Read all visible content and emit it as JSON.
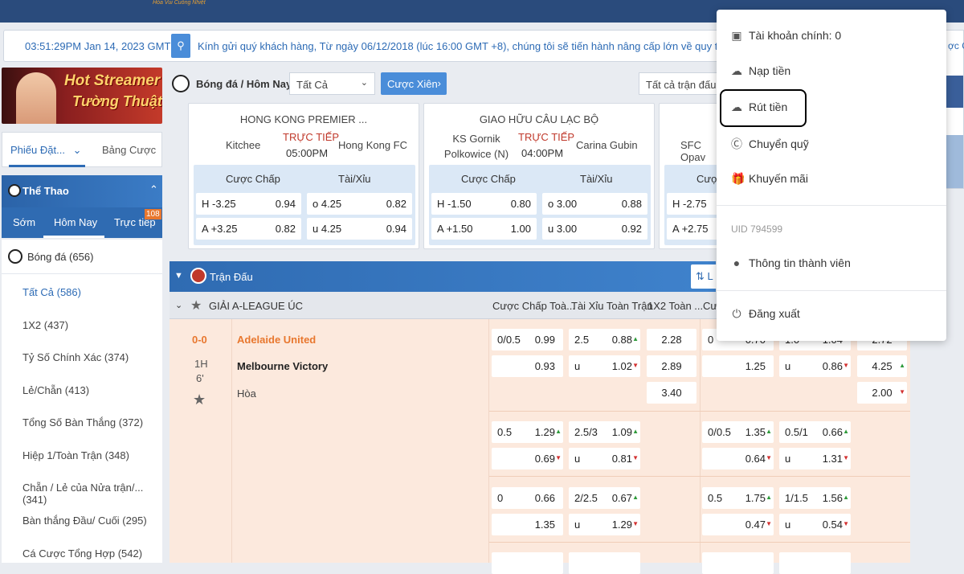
{
  "header": {
    "tagline": "Hòa Vui Cuồng Nhiệt"
  },
  "ticker": {
    "time": "03:51:29PM Jan 14, 2023 GMT +7",
    "message": "Kính gửi quý khách hàng, Từ ngày 06/12/2018 (lúc 16:00 GMT +8), chúng tôi sẽ tiến hành nâng cấp lớn về quy trình tiếp nhận c",
    "right_fragment": "ợc CN"
  },
  "banner": {
    "line1": "Hot Streamer",
    "line2": "Tường Thuật"
  },
  "slip": {
    "tab_slip": "Phiếu Đặt...",
    "tab_bets": "Bảng Cược"
  },
  "sport": {
    "title": "Thể Thao",
    "tabs": [
      "Sớm",
      "Hôm Nay",
      "Trực tiếp"
    ],
    "live_count": "108",
    "football": "Bóng đá (656)",
    "items": [
      "Tất Cả (586)",
      "1X2 (437)",
      "Tỷ Số Chính Xác (374)",
      "Lẻ/Chẵn (413)",
      "Tổng Số Bàn Thắng (372)",
      "Hiệp 1/Toàn Trận (348)",
      "Chẵn / Lẻ của Nửa trận/... (341)",
      "Bàn thắng Đầu/ Cuối (295)",
      "Cá Cược Tổng Hợp (542)"
    ]
  },
  "toolbar": {
    "breadcrumb": "Bóng đá / Hôm Nay",
    "filter": "Tất Cả",
    "parlay": "Cược Xiên",
    "matches": "Tất cả trận đấu"
  },
  "cards": [
    {
      "league": "HONG KONG PREMIER ...",
      "home": "Kitchee",
      "away": "Hong Kong FC",
      "live": "TRỰC TIẾP",
      "time": "05:00PM",
      "h_market": "Cược Chấp",
      "ou_market": "Tài/Xỉu",
      "rows": [
        {
          "hc": "H -3.25",
          "hco": "0.94",
          "ou": "o 4.25",
          "ouo": "0.82"
        },
        {
          "hc": "A +3.25",
          "hco": "0.82",
          "ou": "u 4.25",
          "ouo": "0.94"
        }
      ]
    },
    {
      "league": "GIAO HỮU CÂU LẠC BỘ",
      "home": "KS Gornik Polkowice (N)",
      "away": "Carina Gubin",
      "live": "TRỰC TIẾP",
      "time": "04:00PM",
      "h_market": "Cược Chấp",
      "ou_market": "Tài/Xỉu",
      "rows": [
        {
          "hc": "H -1.50",
          "hco": "0.80",
          "ou": "o 3.00",
          "ouo": "0.88"
        },
        {
          "hc": "A +1.50",
          "hco": "1.00",
          "ou": "u 3.00",
          "ouo": "0.92"
        }
      ]
    },
    {
      "league": "",
      "home": "SFC Opav",
      "away": "",
      "live": "",
      "time": "",
      "h_market": "Cược",
      "ou_market": "",
      "rows": [
        {
          "hc": "H -2.75",
          "hco": "",
          "ou": "",
          "ouo": ""
        },
        {
          "hc": "A +2.75",
          "hco": "",
          "ou": "",
          "ouo": ""
        }
      ]
    }
  ],
  "matches": {
    "header": "Trận Đấu",
    "sort_fragment": "L",
    "league": "GIẢI A-LEAGUE ÚC",
    "columns": [
      "Cược Chấp Toà...",
      "Tài Xỉu Toàn Trận",
      "1X2 Toàn ...",
      "Cư"
    ],
    "score": "0-0",
    "period": "1H",
    "minute": "6'",
    "home": "Adelaide United",
    "away": "Melbourne Victory",
    "draw": "Hòa",
    "r1": {
      "hc_line": "0/0.5",
      "hc_h": "0.99",
      "hc_a": "0.93",
      "ou_line": "2.5",
      "ou_o": "0.88",
      "ou_u_lbl": "u",
      "ou_u": "1.02",
      "x1": "2.28",
      "x2": "2.89",
      "xd": "3.40",
      "h1_line": "0",
      "h1_h": "0.70",
      "h1_a": "1.25",
      "h1ou_line": "1.0",
      "h1ou_o": "1.04",
      "h1ou_u_lbl": "u",
      "h1ou_u": "0.86",
      "h1x_1": "2.72",
      "h1x_2": "4.25",
      "h1x_d": "2.00"
    },
    "r2": {
      "hc_line": "0.5",
      "hc_h": "1.29",
      "hc_a": "0.69",
      "ou_line": "2.5/3",
      "ou_o": "1.09",
      "ou_u_lbl": "u",
      "ou_u": "0.81",
      "h1_line": "0/0.5",
      "h1_h": "1.35",
      "h1_a": "0.64",
      "h1ou_line": "0.5/1",
      "h1ou_o": "0.66",
      "h1ou_u_lbl": "u",
      "h1ou_u": "1.31"
    },
    "r3": {
      "hc_line": "0",
      "hc_h": "0.66",
      "hc_a": "1.35",
      "ou_line": "2/2.5",
      "ou_o": "0.67",
      "ou_u_lbl": "u",
      "ou_u": "1.29",
      "h1_line": "0.5",
      "h1_h": "1.75",
      "h1_a": "0.47",
      "h1ou_line": "1/1.5",
      "h1ou_o": "1.56",
      "h1ou_u_lbl": "u",
      "h1ou_u": "0.54"
    }
  },
  "menu": {
    "balance": "Tài khoản chính: 0",
    "deposit": "Nạp tiền",
    "withdraw": "Rút tiền",
    "transfer": "Chuyển quỹ",
    "promo": "Khuyến mãi",
    "uid": "UID 794599",
    "profile": "Thông tin thành viên",
    "logout": "Đăng xuất"
  },
  "colors": {
    "primary": "#2f6bb2",
    "accent": "#4a8dd9",
    "live": "#c0392b",
    "row_bg": "#fce9dd",
    "team_home": "#e8772e"
  }
}
